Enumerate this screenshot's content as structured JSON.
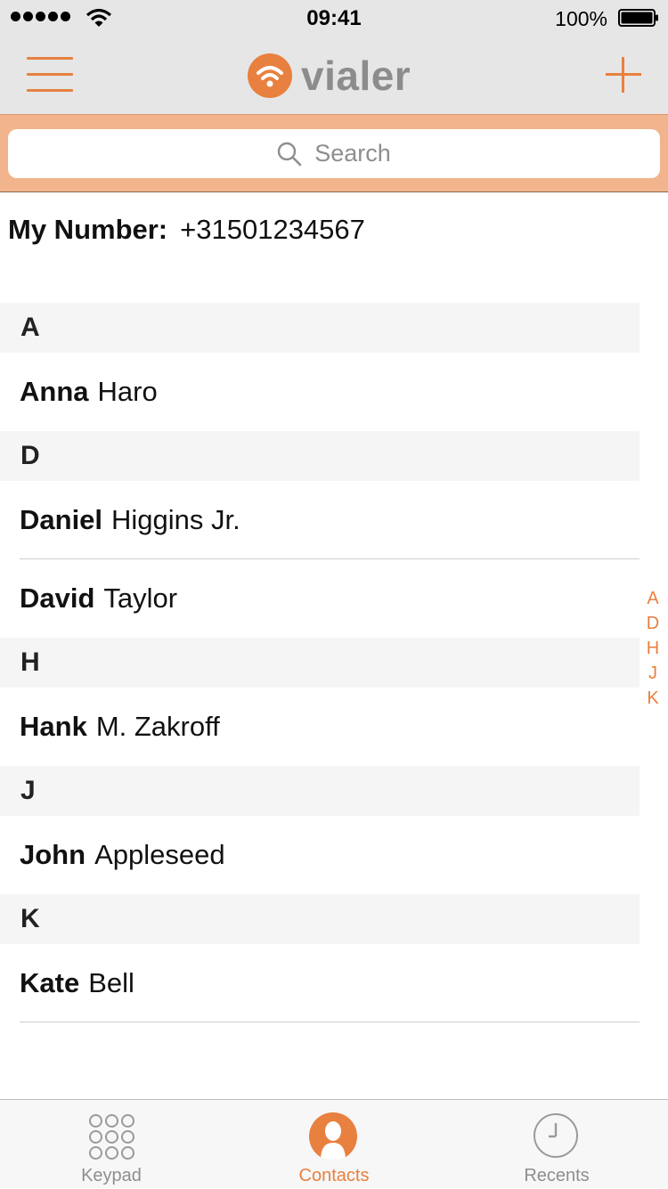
{
  "status_bar": {
    "time": "09:41",
    "battery": "100%"
  },
  "header": {
    "app_name": "vialer"
  },
  "search": {
    "placeholder": "Search"
  },
  "my_number": {
    "label": "My Number:",
    "value": "+31501234567"
  },
  "contacts": {
    "sections": [
      {
        "letter": "A",
        "entries": [
          {
            "first": "Anna",
            "last": "Haro"
          }
        ]
      },
      {
        "letter": "D",
        "entries": [
          {
            "first": "Daniel",
            "last": "Higgins Jr."
          },
          {
            "first": "David",
            "last": "Taylor"
          }
        ]
      },
      {
        "letter": "H",
        "entries": [
          {
            "first": "Hank",
            "last": "M. Zakroff"
          }
        ]
      },
      {
        "letter": "J",
        "entries": [
          {
            "first": "John",
            "last": "Appleseed"
          }
        ]
      },
      {
        "letter": "K",
        "entries": [
          {
            "first": "Kate",
            "last": "Bell"
          }
        ]
      }
    ]
  },
  "index_letters": [
    "A",
    "D",
    "H",
    "J",
    "K"
  ],
  "tabs": [
    {
      "label": "Keypad",
      "icon": "keypad-icon"
    },
    {
      "label": "Contacts",
      "icon": "contacts-icon",
      "active": true
    },
    {
      "label": "Recents",
      "icon": "recents-icon"
    }
  ],
  "colors": {
    "accent": "#e8803f",
    "search_bar_bg": "#f2b48c",
    "nav_bg": "#e6e6e6"
  }
}
